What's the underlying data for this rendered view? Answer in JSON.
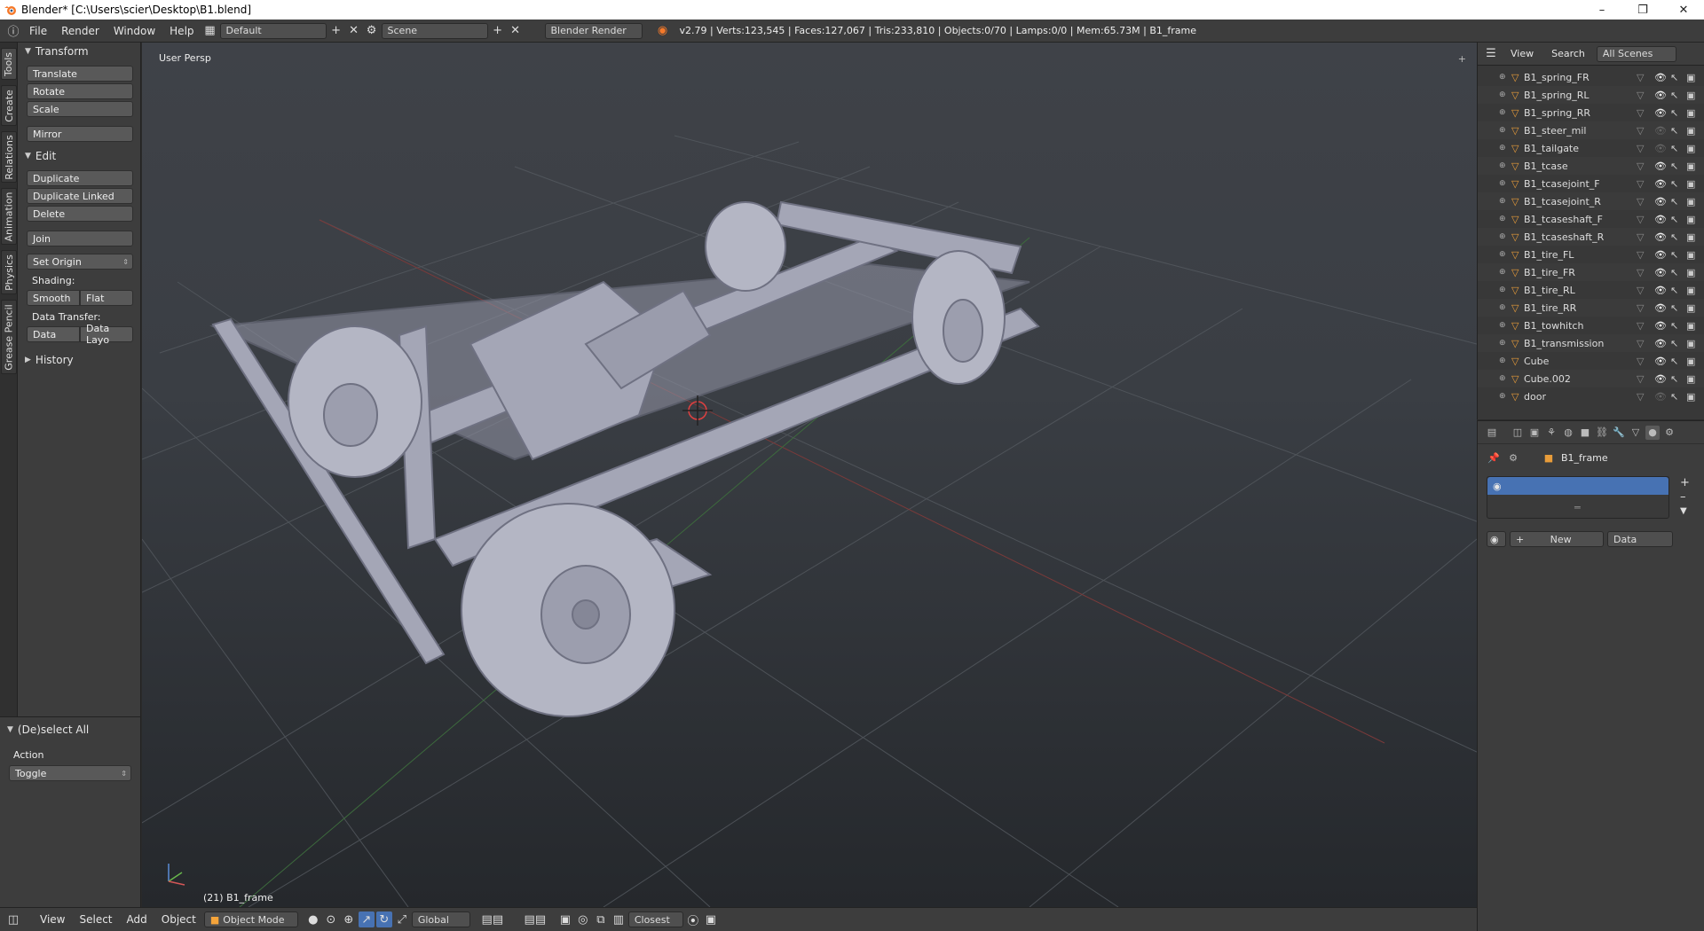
{
  "window": {
    "title": "Blender* [C:\\Users\\scier\\Desktop\\B1.blend]",
    "minimize": "–",
    "maximize": "❐",
    "close": "✕"
  },
  "topbar": {
    "menus": [
      "File",
      "Render",
      "Window",
      "Help"
    ],
    "layout": "Default",
    "scene": "Scene",
    "engine": "Blender Render",
    "stats": "v2.79 | Verts:123,545 | Faces:127,067 | Tris:233,810 | Objects:0/70 | Lamps:0/0 | Mem:65.73M | B1_frame"
  },
  "left_tabs": [
    "Tools",
    "Create",
    "Relations",
    "Animation",
    "Physics",
    "Grease Pencil"
  ],
  "toolshelf": {
    "transform_header": "Transform",
    "transform": [
      "Translate",
      "Rotate",
      "Scale"
    ],
    "mirror": "Mirror",
    "edit_header": "Edit",
    "edit": [
      "Duplicate",
      "Duplicate Linked",
      "Delete"
    ],
    "join": "Join",
    "set_origin": "Set Origin",
    "shading_label": "Shading:",
    "smooth": "Smooth",
    "flat": "Flat",
    "data_transfer_label": "Data Transfer:",
    "data": "Data",
    "data_layout": "Data Layo",
    "history_header": "History"
  },
  "operator": {
    "header": "(De)select All",
    "action_label": "Action",
    "action_value": "Toggle"
  },
  "viewport": {
    "view_name": "User Persp",
    "selected_info": "(21) B1_frame"
  },
  "bottombar": {
    "menus": [
      "View",
      "Select",
      "Add",
      "Object"
    ],
    "mode": "Object Mode",
    "orientation": "Global",
    "snap": "Closest"
  },
  "outliner": {
    "header": [
      "View",
      "Search",
      "All Scenes"
    ],
    "items": [
      {
        "name": "B1_spring_FR",
        "visible": true
      },
      {
        "name": "B1_spring_RL",
        "visible": true
      },
      {
        "name": "B1_spring_RR",
        "visible": true
      },
      {
        "name": "B1_steer_mil",
        "visible": false
      },
      {
        "name": "B1_tailgate",
        "visible": false
      },
      {
        "name": "B1_tcase",
        "visible": true
      },
      {
        "name": "B1_tcasejoint_F",
        "visible": true
      },
      {
        "name": "B1_tcasejoint_R",
        "visible": true
      },
      {
        "name": "B1_tcaseshaft_F",
        "visible": true
      },
      {
        "name": "B1_tcaseshaft_R",
        "visible": true
      },
      {
        "name": "B1_tire_FL",
        "visible": true
      },
      {
        "name": "B1_tire_FR",
        "visible": true
      },
      {
        "name": "B1_tire_RL",
        "visible": true
      },
      {
        "name": "B1_tire_RR",
        "visible": true
      },
      {
        "name": "B1_towhitch",
        "visible": true
      },
      {
        "name": "B1_transmission",
        "visible": true
      },
      {
        "name": "Cube",
        "visible": true
      },
      {
        "name": "Cube.002",
        "visible": true
      },
      {
        "name": "door",
        "visible": false
      }
    ]
  },
  "properties": {
    "object_name": "B1_frame",
    "new_button": "New",
    "data_dropdown": "Data"
  },
  "colors": {
    "accent_blue": "#4772b3",
    "object_orange": "#e89c3a",
    "model_grey": "#a4a6b6"
  }
}
